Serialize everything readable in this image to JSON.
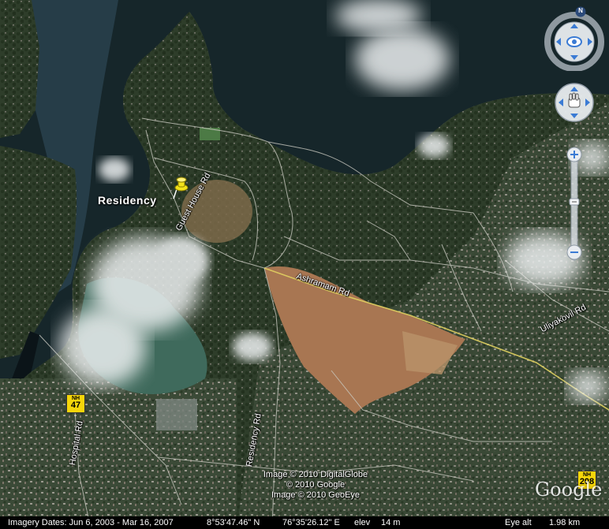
{
  "map": {
    "place_label": "Residency",
    "roads": {
      "guest_house": "Guest House Rd",
      "ashramam": "Ashramam Rd",
      "uliyakovil": "Uliyakovil Rd",
      "hospital": "Hospital Rd",
      "residency": "Residency Rd"
    },
    "shields": [
      {
        "prefix": "NH",
        "number": "47"
      },
      {
        "prefix": "NH",
        "number": "208"
      }
    ],
    "credits": [
      "Image © 2010 DigitalGlobe",
      "© 2010 Google",
      "Image © 2010 GeoEye"
    ],
    "logo": "Google",
    "pin_color": "#f2e21a"
  },
  "nav": {
    "north_label": "N"
  },
  "status": {
    "imagery_dates": "Imagery Dates: Jun 6, 2003 - Mar 16, 2007",
    "latitude": "8°53'47.46\" N",
    "longitude": "76°35'26.12\" E",
    "elev_label": "elev",
    "elev_value": "14 m",
    "eye_alt_label": "Eye alt",
    "eye_alt_value": "1.98 km"
  }
}
